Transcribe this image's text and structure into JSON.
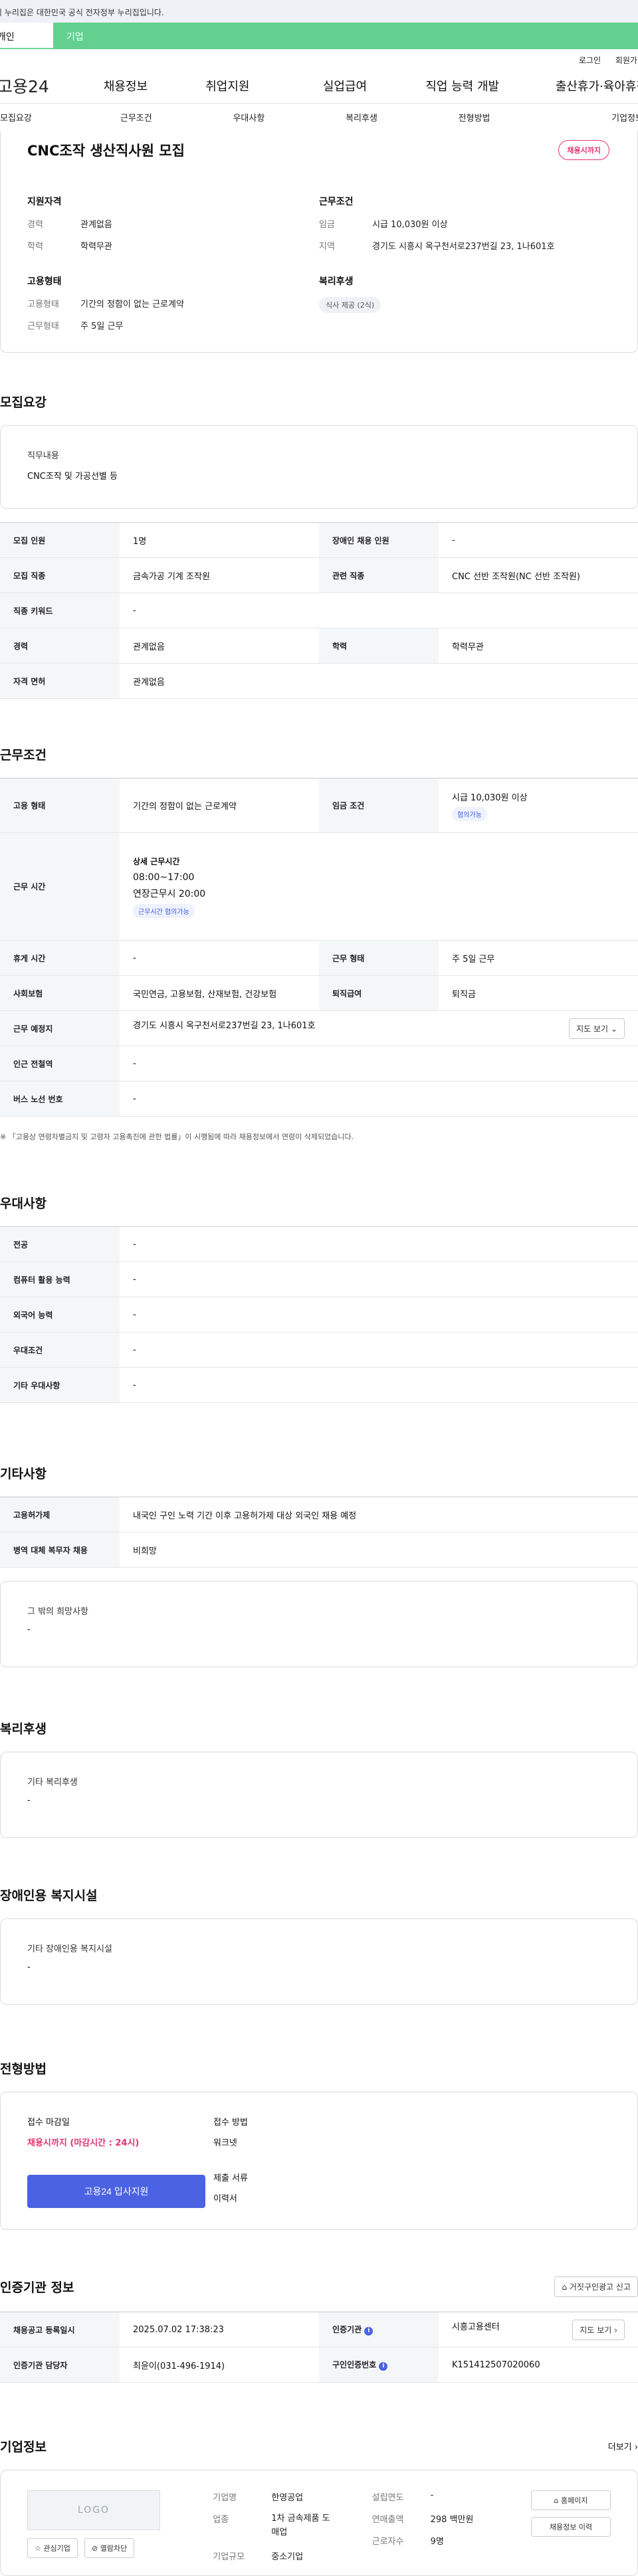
{
  "notice": "이 누리집은 대한민국 공식 전자정부 누리집입니다.",
  "tabs": {
    "individual": "개인",
    "corporate": "기업"
  },
  "util": {
    "login": "로그인",
    "signup": "회원가입"
  },
  "gnb": {
    "logo": "고용24",
    "items": [
      "채용정보",
      "취업지원",
      "실업급여",
      "직업 능력 개발",
      "출산휴가·육아휴직"
    ]
  },
  "lnb": [
    "모집요강",
    "근무조건",
    "우대사항",
    "복리후생",
    "전형방법",
    "기업정보"
  ],
  "job": {
    "title": "CNC조작 생산직사원 모집",
    "status": "채용시까지",
    "qual_title": "지원자격",
    "career_k": "경력",
    "career_v": "관계없음",
    "edu_k": "학력",
    "edu_v": "학력무관",
    "emp_title": "고용형태",
    "emptype_k": "고용형태",
    "emptype_v": "기간의 정함이 없는 근로계약",
    "worktype_k": "근무형태",
    "worktype_v": "주 5일 근무",
    "cond_title": "근무조건",
    "wage_k": "임금",
    "wage_v": "시급 10,030원 이상",
    "region_k": "지역",
    "region_v": "경기도 시흥시 옥구천서로237번길 23, 1나601호",
    "welfare_title": "복리후생",
    "welfare_tag": "식사 제공 (2식)"
  },
  "recruit": {
    "title": "모집요강",
    "duty_h": "직무내용",
    "duty_v": "CNC조작 및 가공선별 등",
    "rows": [
      [
        "모집 인원",
        "1명",
        "장애인 채용 인원",
        "-"
      ],
      [
        "모집 직종",
        "금속가공 기계 조작원",
        "관련 직종",
        "CNC 선반 조작원(NC 선반 조작원)"
      ],
      [
        "직종 키워드",
        "-",
        "",
        ""
      ],
      [
        "경력",
        "관계없음",
        "학력",
        "학력무관"
      ],
      [
        "자격 면허",
        "관계없음",
        "",
        ""
      ]
    ]
  },
  "work": {
    "title": "근무조건",
    "emp_h": "고용 형태",
    "emp_v": "기간의 정함이 없는 근로계약",
    "wage_h": "임금 조건",
    "wage_v": "시급 10,030원 이상",
    "wage_tag": "협의가능",
    "time_h": "근무 시간",
    "time_detail": "상세 근무시간",
    "time_v": "08:00~17:00",
    "time_extra": "연장근무시 20:00",
    "time_tag": "근무시간 협의가능",
    "rest_h": "휴게 시간",
    "rest_v": "-",
    "form_h": "근무 형태",
    "form_v": "주 5일 근무",
    "ins_h": "사회보험",
    "ins_v": "국민연금, 고용보험, 산재보험, 건강보험",
    "ret_h": "퇴직급여",
    "ret_v": "퇴직금",
    "place_h": "근무 예정지",
    "place_v": "경기도 시흥시 옥구천서로237번길 23, 1나601호",
    "map_btn": "지도 보기",
    "subway_h": "인근 전철역",
    "subway_v": "-",
    "bus_h": "버스 노선 번호",
    "bus_v": "-",
    "footnote": "※ 「고용상 연령차별금지 및 고령자 고용촉진에 관한 법률」이 시행됨에 따라 채용정보에서 연령이 삭제되었습니다."
  },
  "pref": {
    "title": "우대사항",
    "rows": [
      [
        "전공",
        "-"
      ],
      [
        "컴퓨터 활용 능력",
        "-"
      ],
      [
        "외국어 능력",
        "-"
      ],
      [
        "우대조건",
        "-"
      ],
      [
        "기타 우대사항",
        "-"
      ]
    ]
  },
  "etc": {
    "title": "기타사항",
    "rows": [
      [
        "고용허가제",
        "내국인 구인 노력 기간 이후 고용허가제 대상 외국인 채용 예정"
      ],
      [
        "병역 대체 복무자 채용",
        "비희망"
      ]
    ],
    "other_h": "그 밖의 희망사항",
    "other_v": "-"
  },
  "welfare": {
    "title": "복리후생",
    "h": "기타 복리후생",
    "v": "-"
  },
  "disabled": {
    "title": "장애인용 복지시설",
    "h": "기타 장애인용 복지시설",
    "v": "-"
  },
  "process": {
    "title": "전형방법",
    "deadline_h": "접수 마감일",
    "deadline_v": "채용시까지 (마감시간 : 24시)",
    "apply_btn": "고용24 입사지원",
    "method_h": "접수 방법",
    "method_v": "워크넷",
    "docs_h": "제출 서류",
    "docs_v": "이력서"
  },
  "agency": {
    "title": "인증기관 정보",
    "report_btn": "거짓구인광고 신고",
    "reg_h": "채용공고 등록일시",
    "reg_v": "2025.07.02 17:38:23",
    "org_h": "인증기관",
    "org_v": "시흥고용센터",
    "map_btn": "지도 보기",
    "mgr_h": "인증기관 담당자",
    "mgr_v": "최윤이(031-496-1914)",
    "num_h": "구인인증번호",
    "num_v": "K151412507020060"
  },
  "company": {
    "title": "기업정보",
    "more": "더보기",
    "logo": "LOGO",
    "fav_btn": "관심기업",
    "block_btn": "열람차단",
    "name_k": "기업명",
    "name_v": "한영공업",
    "ind_k": "업종",
    "ind_v": "1차 금속제품 도매업",
    "size_k": "기업규모",
    "size_v": "중소기업",
    "est_k": "설립연도",
    "est_v": "-",
    "sales_k": "연매출액",
    "sales_v": "298 백만원",
    "emp_k": "근로자수",
    "emp_v": "9명",
    "home_btn": "홈페이지",
    "list_btn": "채용정보 이력"
  }
}
